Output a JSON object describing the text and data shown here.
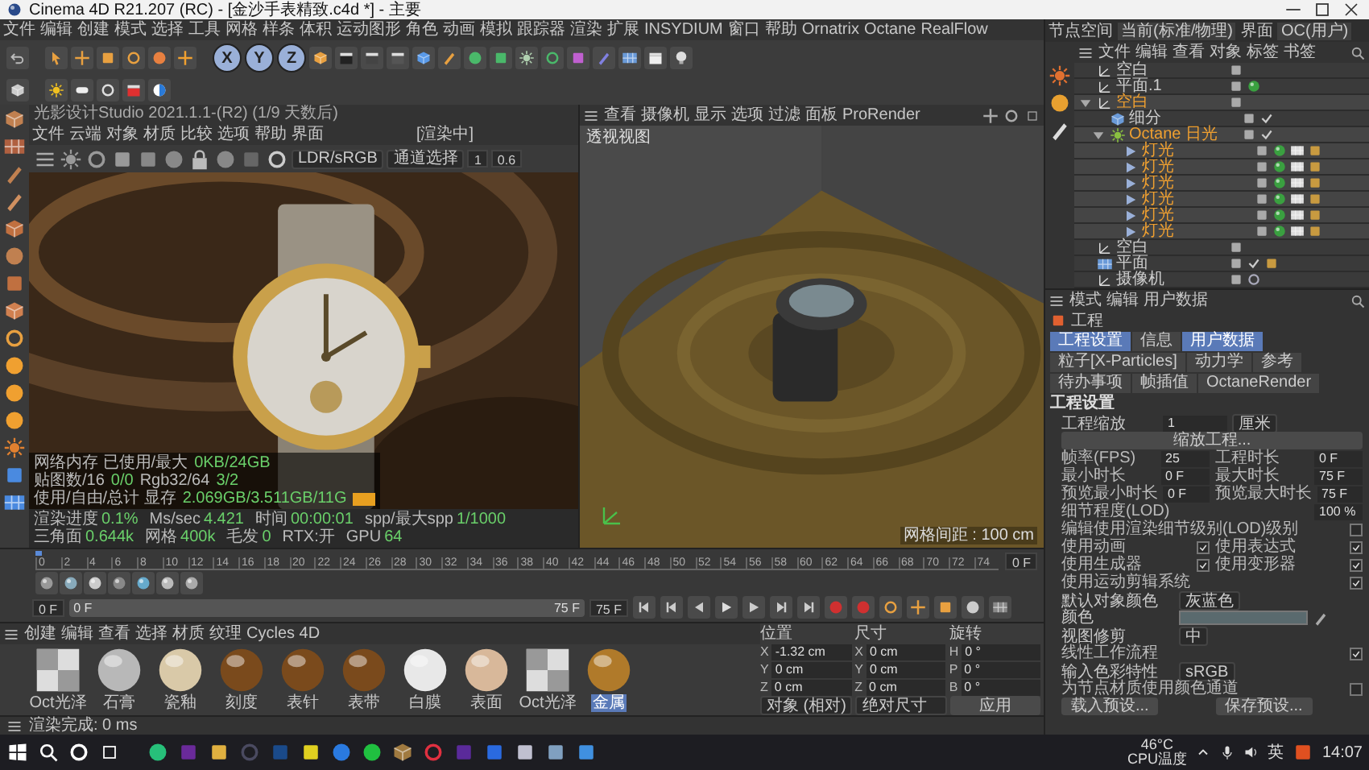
{
  "window": {
    "title": "Cinema 4D R21.207 (RC) - [金沙手表精致.c4d *] - 主要"
  },
  "menu": [
    "文件",
    "编辑",
    "创建",
    "模式",
    "选择",
    "工具",
    "网格",
    "样条",
    "体积",
    "运动图形",
    "角色",
    "动画",
    "模拟",
    "跟踪器",
    "渲染",
    "扩展",
    "INSYDIUM",
    "窗口",
    "帮助",
    "Ornatrix",
    "Octane",
    "RealFlow"
  ],
  "axis_buttons": [
    {
      "label": "X",
      "on": true
    },
    {
      "label": "Y",
      "on": true
    },
    {
      "label": "Z",
      "on": true
    }
  ],
  "octane_viewer": {
    "title": "光影设计Studio 2021.1.1-(R2) (1/9 天数后)",
    "menu": [
      "文件",
      "云端",
      "对象",
      "材质",
      "比较",
      "选项",
      "帮助",
      "界面"
    ],
    "status": "[渲染中]",
    "color_mode": "LDR/sRGB",
    "channel": "通道选择",
    "value_1": "1",
    "value_2": "0.6",
    "overlay": [
      [
        {
          "label": "网络内存 已使用/最大",
          "value": "0KB/24GB"
        }
      ],
      [
        {
          "label": "贴图数/16",
          "value": "0/0"
        },
        {
          "label": "Rgb32/64",
          "value": "3/2"
        }
      ],
      [
        {
          "label": "使用/自由/总计 显存",
          "value": "2.069GB/3.511GB/11G"
        }
      ]
    ],
    "stats": [
      {
        "label": "渲染进度",
        "value": "0.1%"
      },
      {
        "label": "Ms/sec",
        "value": "4.421"
      },
      {
        "label": "时间",
        "value": "00:00:01"
      },
      {
        "label": "spp/最大spp",
        "value": "1/1000"
      },
      {
        "label": "三角面",
        "value": "0.644k"
      },
      {
        "label": "网格",
        "value": "400k"
      },
      {
        "label": "毛发",
        "value": "0"
      },
      {
        "label": "RTX:开"
      },
      {
        "label": "GPU",
        "value": "64"
      }
    ]
  },
  "perspective": {
    "menu": [
      "查看",
      "摄像机",
      "显示",
      "选项",
      "过滤",
      "面板",
      "ProRender"
    ],
    "label": "透视视图",
    "grid_info": "网格间距 : 100 cm"
  },
  "timeline": {
    "level": 0,
    "ticks": [
      "0",
      "2",
      "4",
      "6",
      "8",
      "10",
      "12",
      "14",
      "16",
      "18",
      "20",
      "22",
      "24",
      "26",
      "28",
      "30",
      "32",
      "34",
      "36",
      "38",
      "40",
      "42",
      "44",
      "46",
      "48",
      "50",
      "52",
      "54",
      "56",
      "58",
      "60",
      "62",
      "64",
      "66",
      "68",
      "70",
      "72",
      "74"
    ],
    "frame": "0 F",
    "start": "0 F",
    "range": {
      "start": "0 F",
      "end": "75 F",
      "level": 1
    },
    "end": "75 F"
  },
  "materials": {
    "menu": [
      "创建",
      "编辑",
      "查看",
      "选择",
      "材质",
      "纹理",
      "Cycles 4D"
    ],
    "items": [
      {
        "name": "Oct光泽",
        "kind": "checker",
        "selected": false
      },
      {
        "name": "石膏",
        "kind": "cloudy",
        "selected": false
      },
      {
        "name": "瓷釉",
        "kind": "cream",
        "selected": false
      },
      {
        "name": "刻度",
        "kind": "bronze",
        "selected": false
      },
      {
        "name": "表针",
        "kind": "bronze",
        "selected": false
      },
      {
        "name": "表带",
        "kind": "bronze",
        "selected": false
      },
      {
        "name": "白膜",
        "kind": "white",
        "selected": false
      },
      {
        "name": "表面",
        "kind": "skin",
        "selected": false
      },
      {
        "name": "Oct光泽",
        "kind": "checker",
        "selected": false
      },
      {
        "name": "金属",
        "kind": "gold",
        "selected": true
      }
    ]
  },
  "coordinates": {
    "headers": [
      "位置",
      "尺寸",
      "旋转"
    ],
    "rows": [
      [
        {
          "axis": "X",
          "value": "-1.32 cm"
        },
        {
          "axis": "X",
          "value": "0 cm"
        },
        {
          "axis": "H",
          "value": "0 °"
        }
      ],
      [
        {
          "axis": "Y",
          "value": "0 cm"
        },
        {
          "axis": "Y",
          "value": "0 cm"
        },
        {
          "axis": "P",
          "value": "0 °"
        }
      ],
      [
        {
          "axis": "Z",
          "value": "0 cm"
        },
        {
          "axis": "Z",
          "value": "0 cm"
        },
        {
          "axis": "B",
          "value": "0 °"
        }
      ]
    ],
    "mode": "对象 (相对)",
    "size_mode": "绝对尺寸",
    "apply": "应用"
  },
  "status_bar": "渲染完成: 0 ms",
  "right_top": {
    "node_space_label": "节点空间",
    "node_space": "当前(标准/物理)",
    "layout_label": "界面",
    "layout": "OC(用户)"
  },
  "object_manager": {
    "menu": [
      "文件",
      "编辑",
      "查看",
      "对象",
      "标签",
      "书签"
    ],
    "objects": [
      {
        "name": "空白",
        "kind": "null",
        "selected": false
      },
      {
        "name": "平面.1",
        "kind": "null",
        "selected": false,
        "tags": [
          {
            "kind": "green"
          }
        ]
      },
      {
        "name": "空白",
        "kind": "null",
        "selected": true,
        "expanded": true,
        "children": [
          {
            "name": "细分",
            "kind": "link",
            "selected": false,
            "tags": [
              {
                "kind": "check"
              }
            ]
          },
          {
            "name": "Octane 日光",
            "kind": "sun",
            "selected": true,
            "expanded": true,
            "tags": [
              {
                "kind": "check"
              }
            ],
            "children": [
              {
                "name": "灯光",
                "kind": "light",
                "selected": true,
                "tags": [
                  {
                    "kind": "green"
                  },
                  {
                    "kind": "checker"
                  },
                  {
                    "kind": "gold"
                  }
                ]
              },
              {
                "name": "灯光",
                "kind": "light",
                "selected": true,
                "tags": [
                  {
                    "kind": "green"
                  },
                  {
                    "kind": "checker"
                  },
                  {
                    "kind": "gold"
                  }
                ]
              },
              {
                "name": "灯光",
                "kind": "light",
                "selected": true,
                "tags": [
                  {
                    "kind": "green"
                  },
                  {
                    "kind": "checker"
                  },
                  {
                    "kind": "gold"
                  }
                ]
              },
              {
                "name": "灯光",
                "kind": "light",
                "selected": true,
                "tags": [
                  {
                    "kind": "green"
                  },
                  {
                    "kind": "checker"
                  },
                  {
                    "kind": "gold"
                  }
                ]
              },
              {
                "name": "灯光",
                "kind": "light",
                "selected": true,
                "tags": [
                  {
                    "kind": "green"
                  },
                  {
                    "kind": "checker"
                  },
                  {
                    "kind": "gold"
                  }
                ]
              },
              {
                "name": "灯光",
                "kind": "light",
                "selected": true,
                "tags": [
                  {
                    "kind": "green"
                  },
                  {
                    "kind": "checker"
                  },
                  {
                    "kind": "gold"
                  }
                ]
              }
            ]
          }
        ]
      },
      {
        "name": "空白",
        "kind": "null",
        "selected": false
      },
      {
        "name": "平面",
        "kind": "plane",
        "selected": false,
        "tags": [
          {
            "kind": "check"
          },
          {
            "kind": "gold"
          }
        ]
      },
      {
        "name": "摄像机",
        "kind": "null",
        "selected": false,
        "tags": [
          {
            "kind": "target"
          }
        ]
      }
    ]
  },
  "attributes": {
    "menu": [
      "模式",
      "编辑",
      "用户数据"
    ],
    "object": "工程",
    "tabs": [
      {
        "label": "工程设置",
        "selected": true
      },
      {
        "label": "信息",
        "selected": false
      },
      {
        "label": "用户数据",
        "selected": true
      },
      {
        "label": "粒子[X-Particles]",
        "selected": false
      },
      {
        "label": "动力学",
        "selected": false
      },
      {
        "label": "参考",
        "selected": false
      },
      {
        "label": "待办事项",
        "selected": false
      },
      {
        "label": "帧插值",
        "selected": false
      },
      {
        "label": "OctaneRender",
        "selected": false
      }
    ],
    "section": "工程设置",
    "rows": [
      [
        {
          "kind": "unit",
          "label": "工程缩放",
          "value": "1",
          "unit": "厘米"
        }
      ],
      [
        {
          "kind": "button",
          "label": "缩放工程..."
        }
      ],
      [
        {
          "kind": "field",
          "label": "帧率(FPS)",
          "value": "25"
        },
        {
          "kind": "field",
          "label": "工程时长",
          "value": "0 F"
        }
      ],
      [
        {
          "kind": "field",
          "label": "最小时长",
          "value": "0 F"
        },
        {
          "kind": "field",
          "label": "最大时长",
          "value": "75 F"
        }
      ],
      [
        {
          "kind": "field",
          "label": "预览最小时长",
          "value": "0 F"
        },
        {
          "kind": "field",
          "label": "预览最大时长",
          "value": "75 F"
        }
      ],
      [
        {
          "kind": "field",
          "label": "细节程度(LOD)",
          "value": "100 %"
        }
      ],
      [
        {
          "kind": "check",
          "label": "编辑使用渲染细节级别(LOD)级别",
          "checked": false
        }
      ],
      [
        {
          "kind": "check",
          "label": "使用动画",
          "checked": true
        },
        {
          "kind": "check",
          "label": "使用表达式",
          "checked": true
        }
      ],
      [
        {
          "kind": "check",
          "label": "使用生成器",
          "checked": true
        },
        {
          "kind": "check",
          "label": "使用变形器",
          "checked": true
        }
      ],
      [
        {
          "kind": "check",
          "label": "使用运动剪辑系统",
          "checked": true
        }
      ],
      [
        {
          "kind": "dropdown",
          "label": "默认对象颜色",
          "value": "灰蓝色"
        }
      ],
      [
        {
          "kind": "color",
          "label": "颜色"
        }
      ],
      [
        {
          "kind": "dropdown",
          "label": "视图修剪",
          "value": "中"
        }
      ],
      [
        {
          "kind": "check",
          "label": "线性工作流程",
          "checked": true
        }
      ],
      [
        {
          "kind": "dropdown",
          "label": "输入色彩特性",
          "value": "sRGB"
        }
      ],
      [
        {
          "kind": "check",
          "label": "为节点材质使用颜色通道",
          "checked": false
        }
      ],
      [
        {
          "kind": "button",
          "label": "载入预设..."
        },
        {
          "kind": "button",
          "label": "保存预设..."
        }
      ]
    ]
  },
  "taskbar": {
    "temperature": "46°C",
    "temperature_label": "CPU温度",
    "input_method": "英",
    "time": "14:07"
  }
}
